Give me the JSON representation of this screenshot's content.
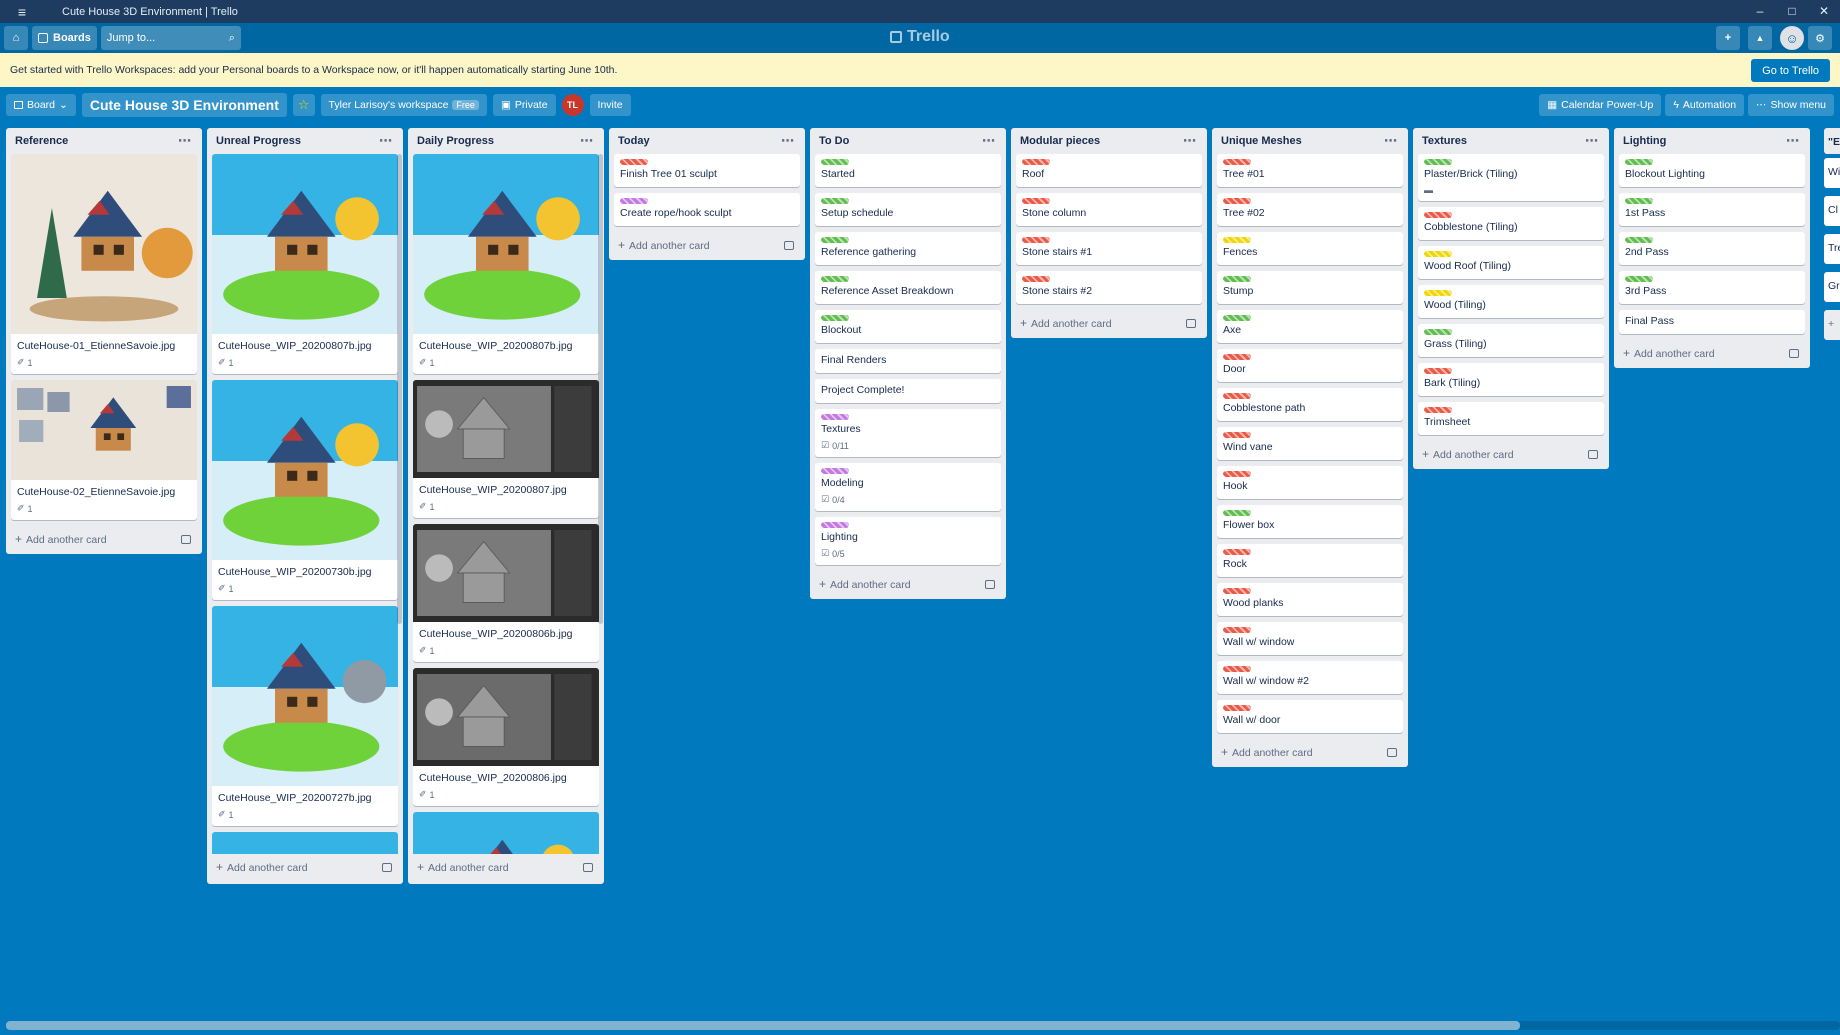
{
  "window": {
    "title": "Cute House 3D Environment | Trello",
    "controls": [
      "–",
      "□",
      "✕"
    ]
  },
  "header": {
    "boards_label": "Boards",
    "search_placeholder": "Jump to...",
    "brand": "Trello"
  },
  "banner": {
    "text": "Get started with Trello Workspaces: add your Personal boards to a Workspace now, or it'll happen automatically starting June 10th.",
    "button": "Go to Trello"
  },
  "board": {
    "view_label": "Board",
    "title": "Cute House 3D Environment",
    "workspace": "Tyler Larisoy's workspace",
    "workspace_badge": "Free",
    "visibility": "Private",
    "member_initials": "TL",
    "invite": "Invite",
    "calendar": "Calendar Power-Up",
    "automation": "Automation",
    "show_menu": "Show menu"
  },
  "add_card_label": "Add another card",
  "lists": [
    {
      "name": "Reference",
      "cards": [
        {
          "title": "CuteHouse-01_EtienneSavoie.jpg",
          "cover": "ref1",
          "attachments": "1"
        },
        {
          "title": "CuteHouse-02_EtienneSavoie.jpg",
          "cover": "ref2",
          "attachments": "1"
        }
      ]
    },
    {
      "name": "Unreal Progress",
      "cards": [
        {
          "title": "CuteHouse_WIP_20200807b.jpg",
          "cover": "sky-tree",
          "attachments": "1"
        },
        {
          "title": "CuteHouse_WIP_20200730b.jpg",
          "cover": "sky-tree",
          "attachments": "1"
        },
        {
          "title": "CuteHouse_WIP_20200727b.jpg",
          "cover": "sky-gray",
          "attachments": "1"
        },
        {
          "title": "",
          "cover": "sky-gray-short"
        }
      ]
    },
    {
      "name": "Daily Progress",
      "cards": [
        {
          "title": "CuteHouse_WIP_20200807b.jpg",
          "cover": "sky-tree",
          "attachments": "1"
        },
        {
          "title": "CuteHouse_WIP_20200807.jpg",
          "cover": "editor",
          "attachments": "1"
        },
        {
          "title": "CuteHouse_WIP_20200806b.jpg",
          "cover": "editor",
          "attachments": "1"
        },
        {
          "title": "CuteHouse_WIP_20200806.jpg",
          "cover": "editor-gray",
          "attachments": "1"
        },
        {
          "title": "",
          "cover": "sky-tree-short"
        }
      ]
    },
    {
      "name": "Today",
      "cards": [
        {
          "title": "Finish Tree 01 sculpt",
          "labels": [
            "red"
          ]
        },
        {
          "title": "Create rope/hook sculpt",
          "labels": [
            "purple"
          ]
        }
      ]
    },
    {
      "name": "To Do",
      "cards": [
        {
          "title": "Started",
          "labels": [
            "green"
          ]
        },
        {
          "title": "Setup schedule",
          "labels": [
            "green"
          ]
        },
        {
          "title": "Reference gathering",
          "labels": [
            "green"
          ]
        },
        {
          "title": "Reference Asset Breakdown",
          "labels": [
            "green"
          ]
        },
        {
          "title": "Blockout",
          "labels": [
            "green"
          ]
        },
        {
          "title": "Final Renders"
        },
        {
          "title": "Project Complete!"
        },
        {
          "title": "Textures",
          "labels": [
            "purple"
          ],
          "checklist": "0/11"
        },
        {
          "title": "Modeling",
          "labels": [
            "purple"
          ],
          "checklist": "0/4"
        },
        {
          "title": "Lighting",
          "labels": [
            "purple"
          ],
          "checklist": "0/5"
        }
      ]
    },
    {
      "name": "Modular pieces",
      "cards": [
        {
          "title": "Roof",
          "labels": [
            "red"
          ]
        },
        {
          "title": "Stone column",
          "labels": [
            "red"
          ]
        },
        {
          "title": "Stone stairs #1",
          "labels": [
            "red"
          ]
        },
        {
          "title": "Stone stairs #2",
          "labels": [
            "red"
          ]
        }
      ]
    },
    {
      "name": "Unique Meshes",
      "cards": [
        {
          "title": "Tree #01",
          "labels": [
            "red"
          ]
        },
        {
          "title": "Tree #02",
          "labels": [
            "red"
          ]
        },
        {
          "title": "Fences",
          "labels": [
            "yellow"
          ]
        },
        {
          "title": "Stump",
          "labels": [
            "green"
          ]
        },
        {
          "title": "Axe",
          "labels": [
            "green"
          ]
        },
        {
          "title": "Door",
          "labels": [
            "red"
          ]
        },
        {
          "title": "Cobblestone path",
          "labels": [
            "red"
          ]
        },
        {
          "title": "Wind vane",
          "labels": [
            "red"
          ]
        },
        {
          "title": "Hook",
          "labels": [
            "red"
          ]
        },
        {
          "title": "Flower box",
          "labels": [
            "green"
          ]
        },
        {
          "title": "Rock",
          "labels": [
            "red"
          ]
        },
        {
          "title": "Wood planks",
          "labels": [
            "red"
          ]
        },
        {
          "title": "Wall w/ window",
          "labels": [
            "red"
          ]
        },
        {
          "title": "Wall w/ window #2",
          "labels": [
            "red"
          ]
        },
        {
          "title": "Wall w/ door",
          "labels": [
            "red"
          ]
        }
      ]
    },
    {
      "name": "Textures",
      "cards": [
        {
          "title": "Plaster/Brick (Tiling)",
          "labels": [
            "green"
          ],
          "comment": true
        },
        {
          "title": "Cobblestone (Tiling)",
          "labels": [
            "red"
          ]
        },
        {
          "title": "Wood Roof (Tiling)",
          "labels": [
            "yellow"
          ]
        },
        {
          "title": "Wood (Tiling)",
          "labels": [
            "yellow"
          ]
        },
        {
          "title": "Grass (Tiling)",
          "labels": [
            "green"
          ]
        },
        {
          "title": "Bark (Tiling)",
          "labels": [
            "red"
          ]
        },
        {
          "title": "Trimsheet",
          "labels": [
            "red"
          ]
        }
      ]
    },
    {
      "name": "Lighting",
      "cards": [
        {
          "title": "Blockout Lighting",
          "labels": [
            "green"
          ]
        },
        {
          "title": "1st Pass",
          "labels": [
            "green"
          ]
        },
        {
          "title": "2nd Pass",
          "labels": [
            "green"
          ]
        },
        {
          "title": "3rd Pass",
          "labels": [
            "green"
          ]
        },
        {
          "title": "Final Pass"
        }
      ]
    }
  ],
  "partial_list": {
    "name": "\"E",
    "cards": [
      "Wi",
      "Cl",
      "Tre",
      "Gr"
    ]
  },
  "icons": {
    "hamburger": "≡",
    "home": "⌂",
    "search": "⌕",
    "plus": "+",
    "bell": "▲",
    "gear": "⚙",
    "star": "☆",
    "lock": "▣",
    "calendar": "▦",
    "bolt": "ϟ",
    "dots": "⋯",
    "paperclip": "✐",
    "checklist": "☑",
    "comment": "▬",
    "chevron": "⌄"
  }
}
